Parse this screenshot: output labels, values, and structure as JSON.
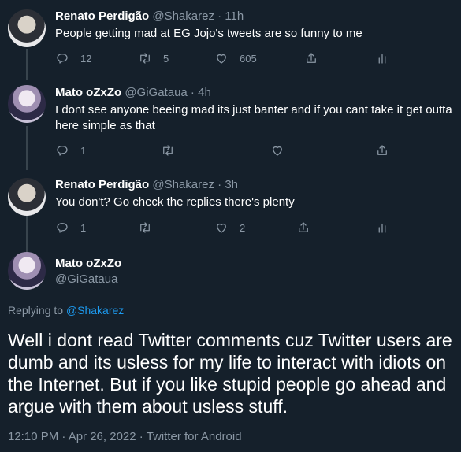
{
  "tweets": [
    {
      "name": "Renato Perdigão",
      "handle": "@Shakarez",
      "time": "11h",
      "text": "People getting mad at EG Jojo's tweets are so funny to me",
      "replies": "12",
      "retweets": "5",
      "likes": "605"
    },
    {
      "name": "Mato oZxZo",
      "handle": "@GiGataua",
      "time": "4h",
      "text": "I dont see anyone beeing mad its just banter and if you cant take it get outta here simple as that",
      "replies": "1",
      "retweets": "",
      "likes": ""
    },
    {
      "name": "Renato Perdigão",
      "handle": "@Shakarez",
      "time": "3h",
      "text": "You don't? Go check the replies there's plenty",
      "replies": "1",
      "retweets": "",
      "likes": "2"
    }
  ],
  "main_tweet": {
    "name": "Mato oZxZo",
    "handle": "@GiGataua",
    "replying_prefix": "Replying to",
    "replying_to": "@Shakarez",
    "text": "Well i dont read Twitter comments cuz Twitter users are dumb and its usless for my life to interact with idiots on the Internet. But if you like stupid people go ahead and argue with them about usless stuff.",
    "timestamp": "12:10 PM · Apr 26, 2022 · Twitter for Android"
  },
  "separator": " · ",
  "icons": [
    "reply-icon",
    "retweet-icon",
    "like-icon",
    "share-icon",
    "analytics-icon"
  ],
  "colors": {
    "background": "#15202b",
    "secondary": "#8b98a5",
    "link": "#1d9bf0",
    "line": "#38444d"
  }
}
